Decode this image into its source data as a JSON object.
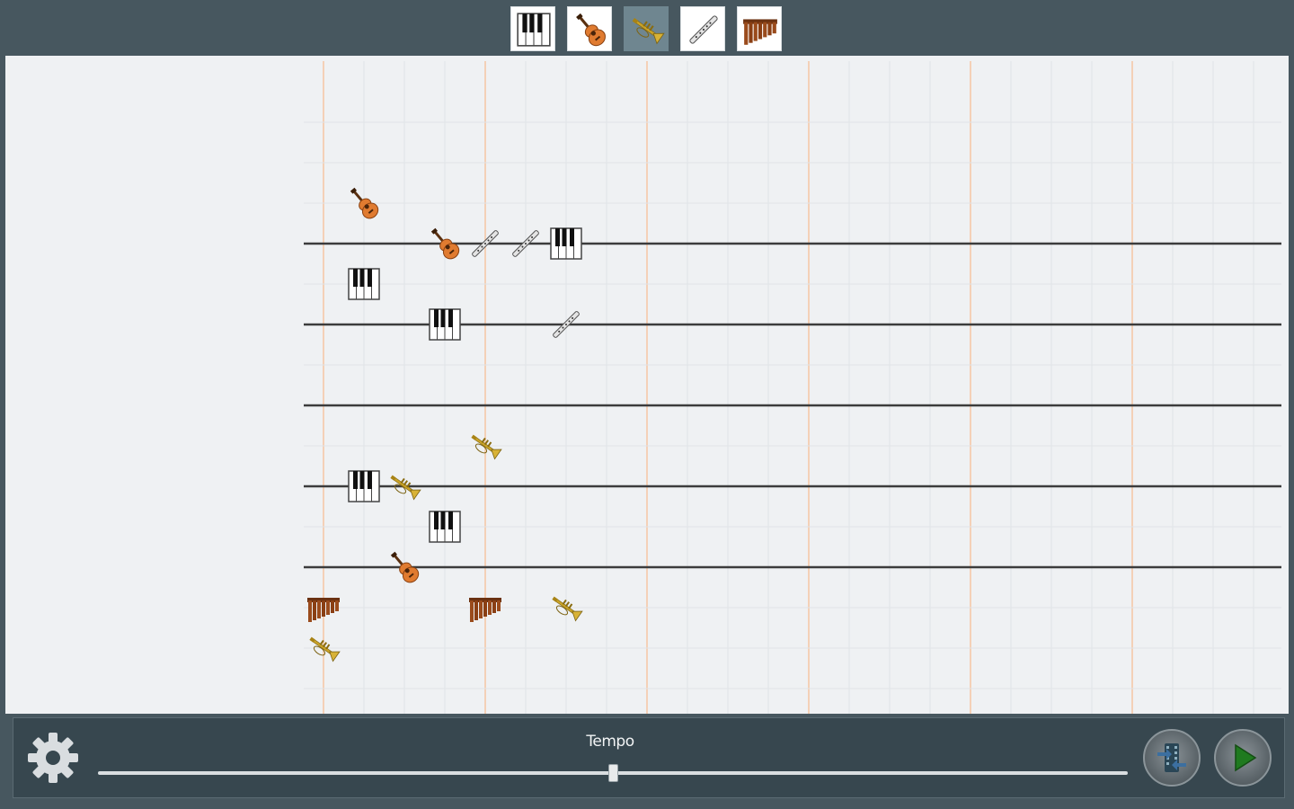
{
  "toolbar": {
    "instruments": [
      {
        "id": "piano",
        "icon": "piano-icon",
        "selected": false
      },
      {
        "id": "guitar",
        "icon": "guitar-icon",
        "selected": false
      },
      {
        "id": "trumpet",
        "icon": "trumpet-icon",
        "selected": true
      },
      {
        "id": "flute",
        "icon": "flute-icon",
        "selected": false
      },
      {
        "id": "xylophone",
        "icon": "xylophone-icon",
        "selected": false
      }
    ]
  },
  "score": {
    "notes": [
      {
        "instrument": "guitar",
        "beat": 1,
        "pitch": 10
      },
      {
        "instrument": "guitar",
        "beat": 3,
        "pitch": 9
      },
      {
        "instrument": "flute",
        "beat": 4,
        "pitch": 9
      },
      {
        "instrument": "flute",
        "beat": 5,
        "pitch": 9
      },
      {
        "instrument": "piano",
        "beat": 6,
        "pitch": 9
      },
      {
        "instrument": "piano",
        "beat": 1,
        "pitch": 8
      },
      {
        "instrument": "piano",
        "beat": 3,
        "pitch": 7
      },
      {
        "instrument": "flute",
        "beat": 6,
        "pitch": 7
      },
      {
        "instrument": "trumpet",
        "beat": 4,
        "pitch": 4
      },
      {
        "instrument": "piano",
        "beat": 1,
        "pitch": 3
      },
      {
        "instrument": "trumpet",
        "beat": 2,
        "pitch": 3
      },
      {
        "instrument": "piano",
        "beat": 3,
        "pitch": 2
      },
      {
        "instrument": "guitar",
        "beat": 2,
        "pitch": 1
      },
      {
        "instrument": "xylophone",
        "beat": 0,
        "pitch": 0
      },
      {
        "instrument": "xylophone",
        "beat": 4,
        "pitch": 0
      },
      {
        "instrument": "trumpet",
        "beat": 6,
        "pitch": 0
      },
      {
        "instrument": "trumpet",
        "beat": 0,
        "pitch": -1
      }
    ]
  },
  "controls": {
    "settings_icon": "gear-icon",
    "tempo_label": "Tempo",
    "tempo_value": 0.5,
    "shuffle_icon": "shuffle-icon",
    "play_icon": "play-icon"
  },
  "colors": {
    "frame": "#47575f",
    "canvas": "#eff1f3",
    "control_bar": "#37474f",
    "selected_tool": "#6f8690",
    "staff_line": "#3c3c3c",
    "measure_line": "#f5c9a8",
    "play_green": "#1f7a1f"
  }
}
